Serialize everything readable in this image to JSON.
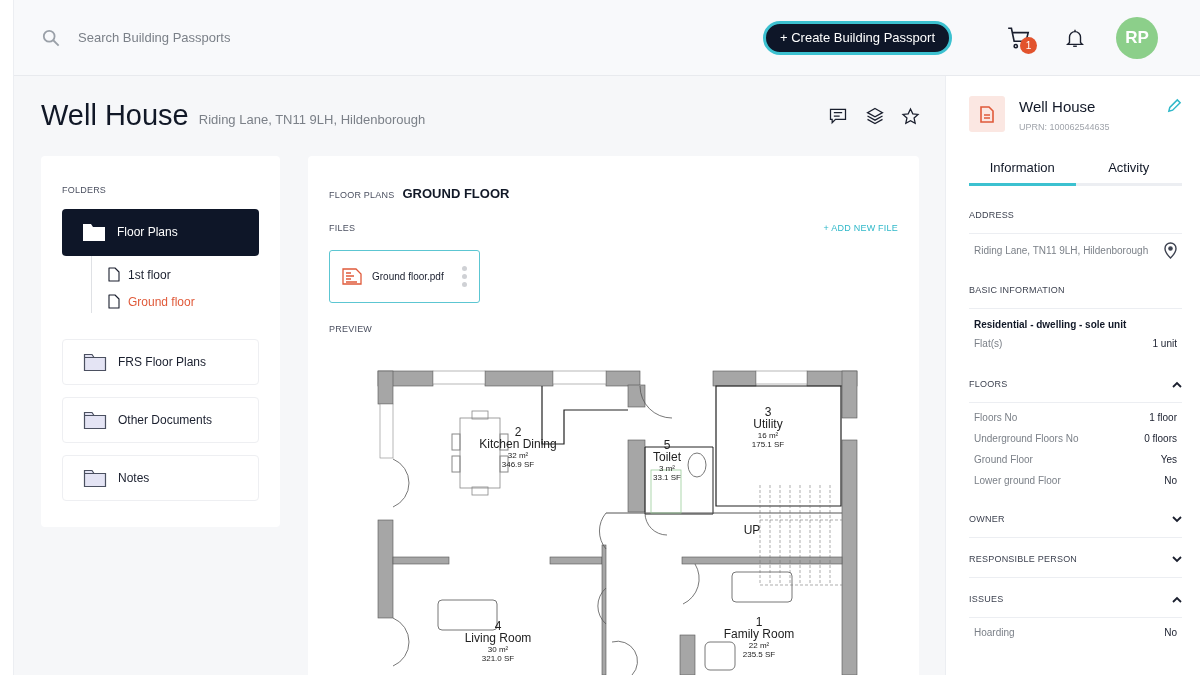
{
  "header": {
    "search": {
      "placeholder": "Search Building Passports"
    },
    "create_button": "+ Create Building Passport",
    "cart_badge": "1",
    "avatar": "RP"
  },
  "page": {
    "title": "Well House",
    "address": "Riding Lane, TN11 9LH, Hildenborough"
  },
  "folders": {
    "heading": "FOLDERS",
    "items": [
      {
        "label": "Floor Plans",
        "selected": true,
        "children": [
          {
            "label": "1st floor",
            "selected": false
          },
          {
            "label": "Ground floor",
            "selected": true
          }
        ]
      },
      {
        "label": "FRS Floor Plans",
        "selected": false
      },
      {
        "label": "Other Documents",
        "selected": false
      },
      {
        "label": "Notes",
        "selected": false
      }
    ]
  },
  "content": {
    "breadcrumb": "FLOOR PLANS",
    "title": "GROUND FLOOR",
    "files_label": "FILES",
    "add_file": "+ ADD NEW FILE",
    "files": [
      {
        "name": "Ground floor.pdf",
        "selected": true
      }
    ],
    "preview_label": "PREVIEW",
    "floor_plan": {
      "stair_label": "UP",
      "rooms": [
        {
          "number": "2",
          "name": "Kitchen Dining",
          "area": "32 m²",
          "imperial_area": "346.9 SF"
        },
        {
          "number": "3",
          "name": "Utility",
          "area": "16 m²",
          "imperial_area": "175.1 SF"
        },
        {
          "number": "5",
          "name": "Toilet",
          "area": "3 m²",
          "imperial_area": "33.1 SF"
        },
        {
          "number": "4",
          "name": "Living Room",
          "area": "30 m²",
          "imperial_area": "321.0 SF"
        },
        {
          "number": "1",
          "name": "Family Room",
          "area": "22 m²",
          "imperial_area": "235.5 SF"
        }
      ]
    }
  },
  "details": {
    "title": "Well House",
    "uprn": "UPRN: 100062544635",
    "tabs": [
      {
        "label": "Information",
        "selected": true
      },
      {
        "label": "Activity",
        "selected": false
      }
    ],
    "sections": [
      {
        "kind": "address",
        "title": "ADDRESS",
        "value": "Riding Lane, TN11 9LH, Hildenborough"
      },
      {
        "kind": "basic",
        "title": "BASIC INFORMATION",
        "subtitle": "Residential - dwelling - sole unit",
        "rows": [
          {
            "label": "Flat(s)",
            "value": "1 unit"
          }
        ]
      },
      {
        "kind": "collapsible",
        "title": "FLOORS",
        "expanded": true,
        "rows": [
          {
            "label": "Floors No",
            "value": "1 floor"
          },
          {
            "label": "Underground Floors No",
            "value": "0 floors"
          },
          {
            "label": "Ground Floor",
            "value": "Yes"
          },
          {
            "label": "Lower ground Floor",
            "value": "No"
          }
        ]
      },
      {
        "kind": "collapsible",
        "title": "OWNER",
        "expanded": false
      },
      {
        "kind": "collapsible",
        "title": "RESPONSIBLE PERSON",
        "expanded": false
      },
      {
        "kind": "collapsible",
        "title": "ISSUES",
        "expanded": true,
        "rows": [
          {
            "label": "Hoarding",
            "value": "No"
          }
        ]
      }
    ]
  }
}
